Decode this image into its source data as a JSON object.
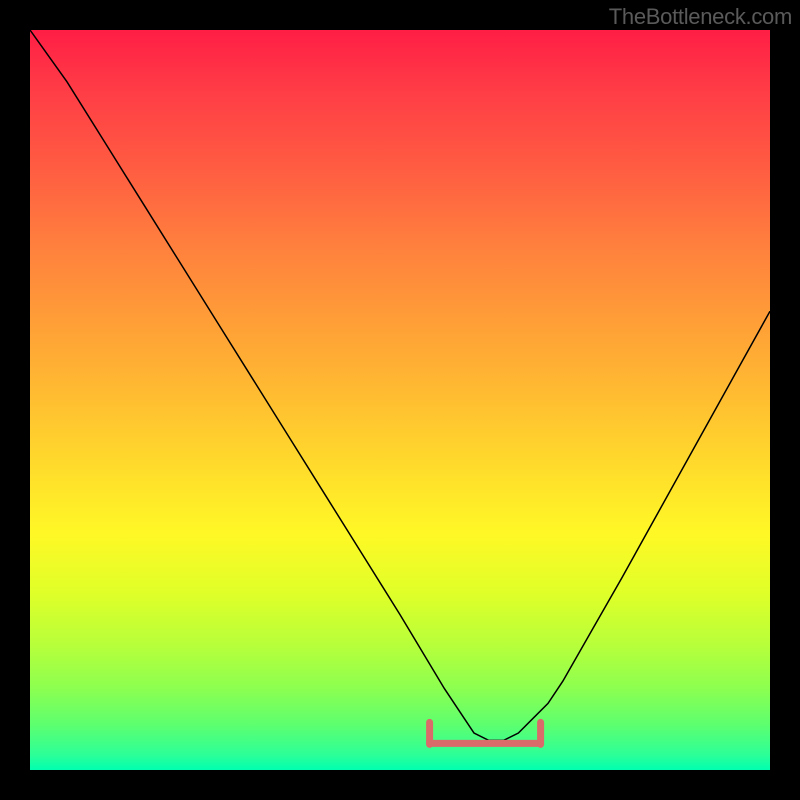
{
  "watermark": "TheBottleneck.com",
  "chart_data": {
    "type": "line",
    "title": "",
    "xlabel": "",
    "ylabel": "",
    "xlim": [
      0,
      100
    ],
    "ylim": [
      0,
      100
    ],
    "description": "V-shaped bottleneck curve on heat gradient (red=high bottleneck, green=low), minimum near x≈62, with horizontal bracket showing optimal range",
    "gradient_colors": {
      "top": "#FF1E45",
      "middle": "#FFD82C",
      "bottom": "#00FFB0"
    },
    "series": [
      {
        "name": "bottleneck-curve",
        "x": [
          0,
          5,
          10,
          15,
          20,
          25,
          30,
          35,
          40,
          45,
          50,
          53,
          56,
          58,
          60,
          62,
          64,
          66,
          68,
          70,
          72,
          76,
          80,
          85,
          90,
          95,
          100
        ],
        "values": [
          100,
          93,
          85,
          77,
          69,
          61,
          53,
          45,
          37,
          29,
          21,
          16,
          11,
          8,
          5,
          4,
          4,
          5,
          7,
          9,
          12,
          19,
          26,
          35,
          44,
          53,
          62
        ]
      }
    ],
    "optimal_range": {
      "start_x": 54,
      "end_x": 69,
      "y": 4
    }
  }
}
